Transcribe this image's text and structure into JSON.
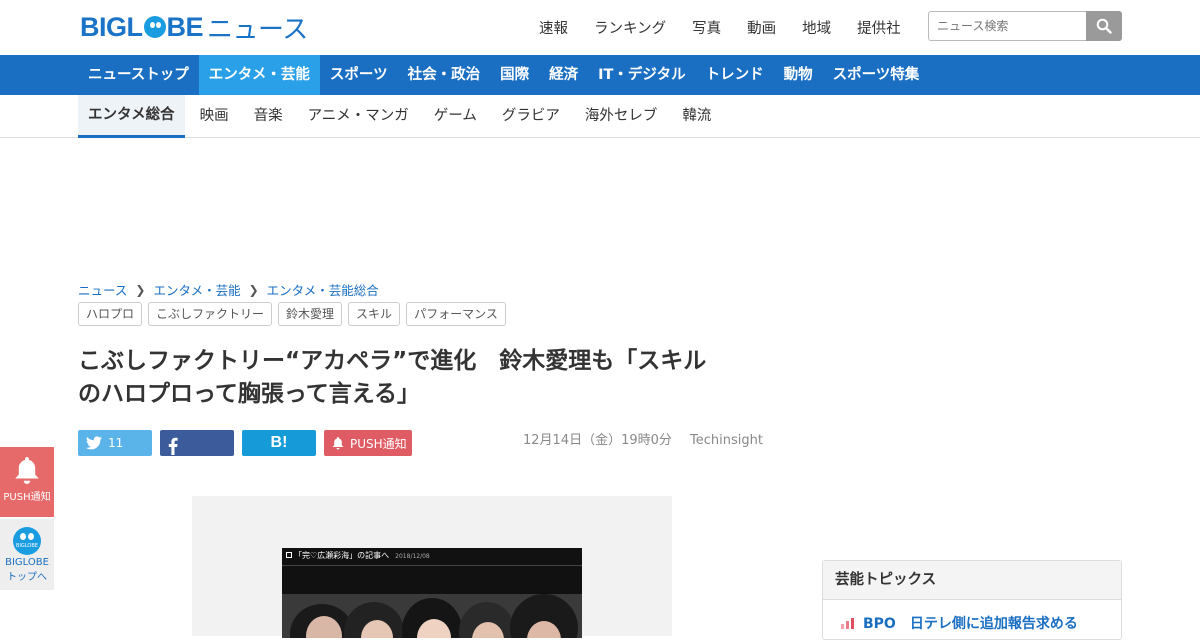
{
  "header": {
    "logo_text": "BIGLOBEニュース",
    "top_links": [
      "速報",
      "ランキング",
      "写真",
      "動画",
      "地域",
      "提供社"
    ],
    "search_placeholder": "ニュース検索"
  },
  "main_nav": [
    "ニューストップ",
    "エンタメ・芸能",
    "スポーツ",
    "社会・政治",
    "国際",
    "経済",
    "IT・デジタル",
    "トレンド",
    "動物",
    "スポーツ特集"
  ],
  "main_nav_active": 1,
  "sub_nav": [
    "エンタメ総合",
    "映画",
    "音楽",
    "アニメ・マンガ",
    "ゲーム",
    "グラビア",
    "海外セレブ",
    "韓流"
  ],
  "sub_nav_active": 0,
  "breadcrumb": [
    "ニュース",
    "エンタメ・芸能",
    "エンタメ・芸能総合"
  ],
  "tags": [
    "ハロプロ",
    "こぶしファクトリー",
    "鈴木愛理",
    "スキル",
    "パフォーマンス"
  ],
  "article": {
    "title_line1": "こぶしファクトリー“アカペラ”で進化　鈴木愛理も「スキル",
    "title_line2": "のハロプロって胸張って言える」",
    "date": "12月14日（金）19時0分",
    "source": "Techinsight",
    "photo_caption": "「完♡広瀬彩海」の記事へ",
    "photo_date": "2018/12/08"
  },
  "share": {
    "twitter_count": "11",
    "hatena_label": "B!",
    "push_label": "PUSH通知"
  },
  "side_buttons": {
    "push": "PUSH通知",
    "top_logo": "BIGLOBE",
    "top_line1": "BIGLOBE",
    "top_line2": "トップへ"
  },
  "topics": {
    "heading": "芸能トピックス",
    "first_item": "BPO　日テレ側に追加報告求める"
  },
  "colors": {
    "brand_blue": "#1b6fc2",
    "nav_active": "#2aa0e8",
    "twitter": "#5ab4ea",
    "facebook": "#3b5b9a",
    "hatena": "#169bd8",
    "push": "#e05c64"
  }
}
